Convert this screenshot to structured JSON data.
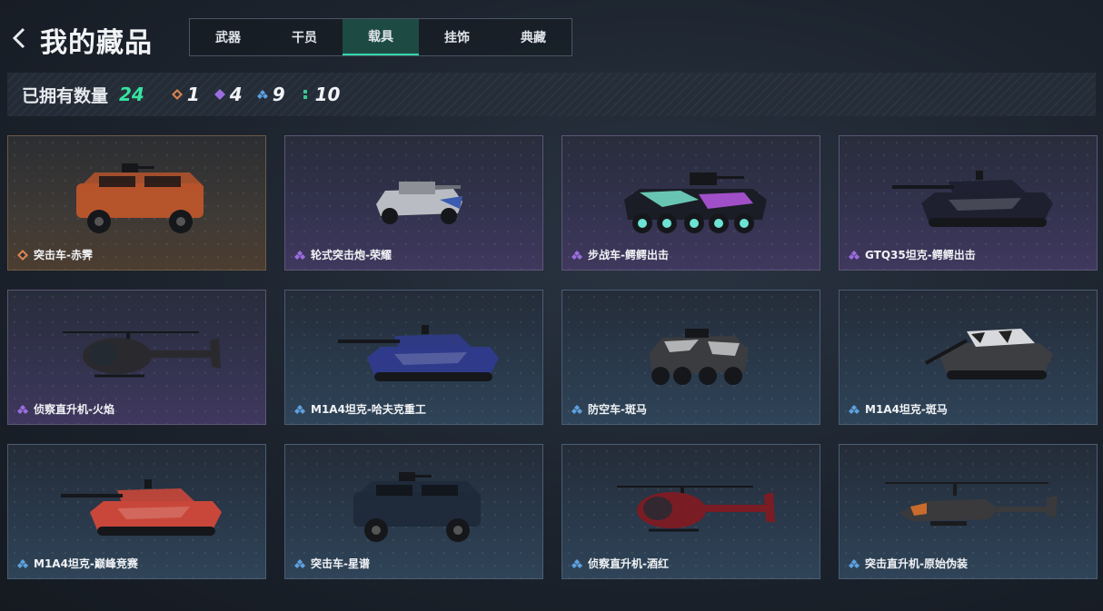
{
  "header": {
    "title": "我的藏品",
    "tabs": [
      {
        "label": "武器",
        "active": false
      },
      {
        "label": "干员",
        "active": false
      },
      {
        "label": "载具",
        "active": true
      },
      {
        "label": "挂饰",
        "active": false
      },
      {
        "label": "典藏",
        "active": false
      }
    ]
  },
  "stats": {
    "owned_label": "已拥有数量",
    "owned_count": "24",
    "rarities": [
      {
        "icon": "orange-diamond-icon",
        "color": "#d9824f",
        "count": "1"
      },
      {
        "icon": "purple-diamond-icon",
        "color": "#9b6ee0",
        "count": "4"
      },
      {
        "icon": "blue-diamond-icon",
        "color": "#5ea1e0",
        "count": "9"
      },
      {
        "icon": "green-dots-icon",
        "color": "#36c98f",
        "count": "10"
      }
    ]
  },
  "colors": {
    "accent": "#37e3a0",
    "orange": "#d9824f",
    "purple": "#9b6ee0",
    "blue": "#5ea1e0"
  },
  "items": [
    {
      "name": "突击车-赤霁",
      "rarity": "orange",
      "vehicle": "truck",
      "paint": "#b6542c"
    },
    {
      "name": "轮式突击炮-荣耀",
      "rarity": "purple",
      "vehicle": "assault-gun",
      "paint": "#b9bcc2"
    },
    {
      "name": "步战车-鳄鳄出击",
      "rarity": "purple",
      "vehicle": "ifv",
      "paint": "#1b1d26"
    },
    {
      "name": "GTQ35坦克-鳄鳄出击",
      "rarity": "purple",
      "vehicle": "tank",
      "paint": "#1e2030"
    },
    {
      "name": "侦察直升机-火焰",
      "rarity": "purple",
      "vehicle": "heli-small",
      "paint": "#2a2a2e"
    },
    {
      "name": "M1A4坦克-哈夫克重工",
      "rarity": "blue",
      "vehicle": "tank",
      "paint": "#2f3b8a"
    },
    {
      "name": "防空车-斑马",
      "rarity": "blue",
      "vehicle": "apc",
      "paint": "#3a3c40"
    },
    {
      "name": "M1A4坦克-斑马",
      "rarity": "blue",
      "vehicle": "tank-angled",
      "paint": "#3d3e42"
    },
    {
      "name": "M1A4坦克-巅峰竞赛",
      "rarity": "blue",
      "vehicle": "tank",
      "paint": "#c9473a"
    },
    {
      "name": "突击车-星谱",
      "rarity": "blue",
      "vehicle": "truck",
      "paint": "#1f2a3a"
    },
    {
      "name": "侦察直升机-酒红",
      "rarity": "blue",
      "vehicle": "heli-small",
      "paint": "#7a1c24"
    },
    {
      "name": "突击直升机-原始伪装",
      "rarity": "blue",
      "vehicle": "heli-attack",
      "paint": "#3a3a3c"
    }
  ]
}
